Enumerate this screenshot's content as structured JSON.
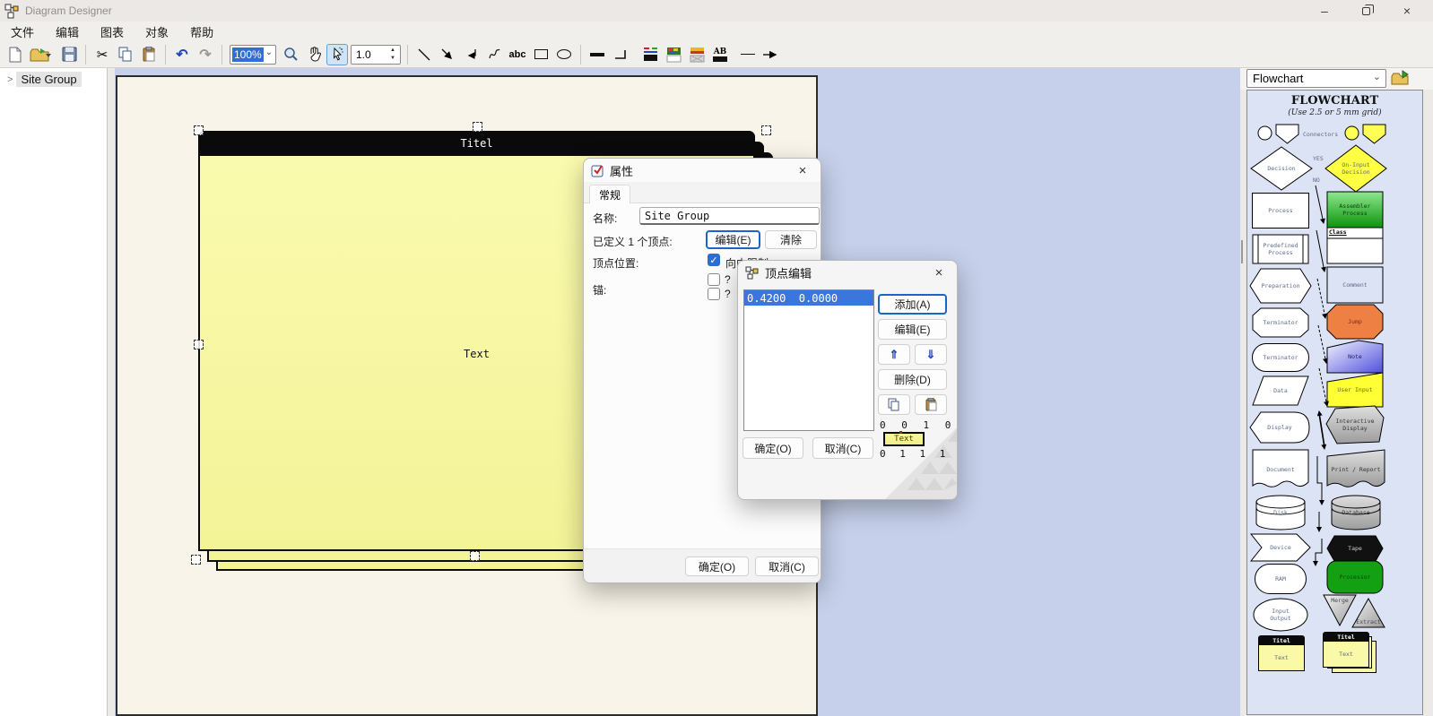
{
  "window": {
    "title": "Diagram Designer"
  },
  "icons": {
    "minimize": "–",
    "close": "×",
    "dropdown_chevron": "⌄",
    "undo": "↶",
    "redo": "↷",
    "cut": "✂",
    "up_arrow": "⇑",
    "down_arrow": "⇓",
    "tree_expand": ">",
    "spin_up": "▲",
    "spin_down": "▼"
  },
  "menu": {
    "items": [
      "文件",
      "编辑",
      "图表",
      "对象",
      "帮助"
    ]
  },
  "toolbar": {
    "zoom_value": "100%",
    "line_width": "1.0",
    "text_tool": "abc",
    "text_color_tool": "AB"
  },
  "tree": {
    "item": "Site Group"
  },
  "canvas": {
    "note_title": "Titel",
    "note_text": "Text"
  },
  "properties_dialog": {
    "title": "属性",
    "tab_general": "常规",
    "name_label": "名称:",
    "name_value": "Site Group",
    "vertices_label": "已定义 1 个顶点:",
    "edit_button": "编辑(E)",
    "clear_button": "清除",
    "vertex_pos_label": "顶点位置:",
    "inward_limit_label": "向内限制",
    "anchor_label": "锚:",
    "anchor_q1": "?",
    "anchor_q2": "?",
    "ok_button": "确定(O)",
    "cancel_button": "取消(C)"
  },
  "vertex_dialog": {
    "title": "顶点编辑",
    "list_item": "0.4200  0.0000",
    "add_button": "添加(A)",
    "edit_button": "编辑(E)",
    "delete_button": "删除(D)",
    "ok_button": "确定(O)",
    "cancel_button": "取消(C)",
    "coords_top": "0 0 1 0",
    "coords_bottom": "0 1 1 1",
    "preview_text": "Text"
  },
  "palette": {
    "selector_value": "Flowchart",
    "header_title": "FLOWCHART",
    "header_subtitle": "(Use 2.5 or 5 mm grid)",
    "connectors": "Connectors",
    "yes": "YES",
    "no": "NO",
    "decision": "Decision",
    "on_input_decision": "On-Input\nDecision",
    "process": "Process",
    "assembler_process": "Assembler\nProcess",
    "predefined_process": "Predefined\nProcess",
    "class_shape": "Class",
    "preparation": "Preparation",
    "comment": "Comment",
    "terminator1": "Terminator",
    "terminator2": "Terminator",
    "jump": "Jump",
    "note": "Note",
    "data": "Data",
    "user_input": "User Input",
    "display": "Display",
    "interactive_display": "Interactive\nDisplay",
    "document": "Document",
    "print_report": "Print / Report",
    "disk": "Disk",
    "database": "Database",
    "device": "Device",
    "tape": "Tape",
    "ram": "RAM",
    "processor": "Processor",
    "input_output": "Input\nOutput",
    "merge": "Merge",
    "extract": "Extract",
    "note_title": "Titel",
    "note_text": "Text",
    "note_title2": "Titel",
    "note_text2": "Text"
  },
  "colors": {
    "selection_blue": "#3b76dd",
    "accent_blue": "#2d6fd0",
    "note_yellow": "#f9f9a6",
    "canvas_blue": "#c6d0ea",
    "page_cream": "#f8f4e9",
    "palette_bg": "#dce3f5",
    "assembler_green": "#22bb22",
    "processor_green": "#13a013",
    "jump_orange": "#ee8044",
    "note_blue": "#5a5ae0",
    "user_input_yellow": "#ffff33",
    "shape_gray": "#b9b9b9",
    "tape_black": "#111111"
  }
}
